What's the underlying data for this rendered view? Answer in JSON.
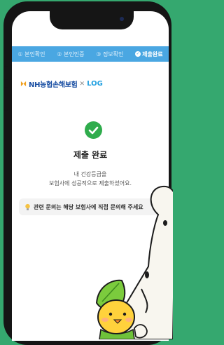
{
  "steps": [
    {
      "num": "①",
      "label": "본인확인"
    },
    {
      "num": "②",
      "label": "본인인증"
    },
    {
      "num": "③",
      "label": "정보확인"
    },
    {
      "num": "✓",
      "label": "제출완료"
    }
  ],
  "logo": {
    "partner": "NH농협손해보험",
    "separator": "✕",
    "brand": "LOG"
  },
  "result": {
    "title": "제출 완료",
    "message_line1": "내 건강등급을",
    "message_line2": "보험사에 성공적으로 제출하셨어요."
  },
  "notice": {
    "text": "관련 문의는 해당 보험사에 직접 문의해 주세요"
  },
  "colors": {
    "background": "#35a86f",
    "step_bar": "#4aa7e2",
    "check": "#2fac4c",
    "nh_blue": "#1a4fa3",
    "log_blue": "#23a0e0"
  },
  "icons": [
    "check-circle-icon",
    "lightbulb-icon",
    "nh-logo-icon"
  ]
}
